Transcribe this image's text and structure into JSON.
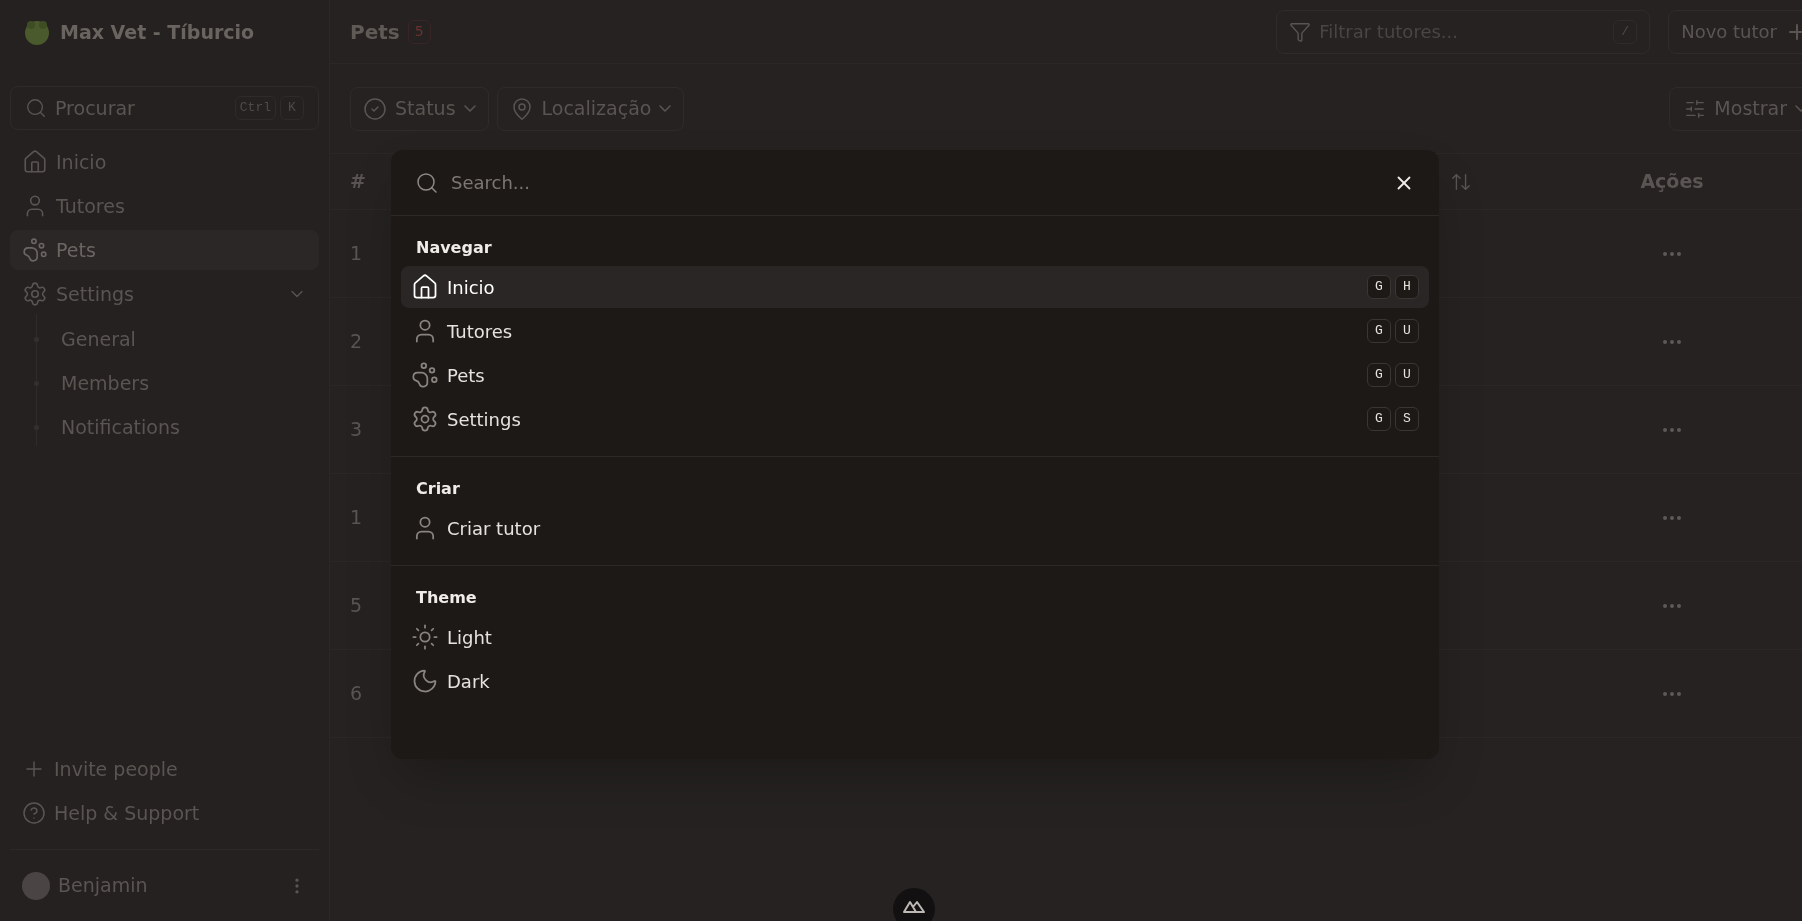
{
  "app": {
    "title": "Max Vet - Tíburcio"
  },
  "sidebar": {
    "search": {
      "placeholder": "Procurar",
      "shortcut": [
        "Ctrl",
        "K"
      ]
    },
    "items": [
      {
        "label": "Inicio",
        "kind": "home",
        "selected": false
      },
      {
        "label": "Tutores",
        "kind": "user",
        "selected": false
      },
      {
        "label": "Pets",
        "kind": "paw",
        "selected": true
      },
      {
        "label": "Settings",
        "kind": "gear",
        "selected": false,
        "expanded": true,
        "children": [
          {
            "label": "General"
          },
          {
            "label": "Members"
          },
          {
            "label": "Notifications"
          }
        ]
      }
    ],
    "footer_items": [
      {
        "label": "Invite people",
        "kind": "plus"
      },
      {
        "label": "Help & Support",
        "kind": "help"
      }
    ],
    "user": {
      "name": "Benjamin"
    }
  },
  "header": {
    "title": "Pets",
    "count": "5",
    "filter": {
      "placeholder": "Filtrar tutores...",
      "shortcut": "/"
    },
    "new_button": "Novo tutor"
  },
  "filters": [
    {
      "label": "Status",
      "kind": "check"
    },
    {
      "label": "Localização",
      "kind": "pin"
    }
  ],
  "display_button": "Mostrar",
  "table": {
    "columns": [
      "#",
      "Ações"
    ],
    "rows": [
      "1",
      "2",
      "3",
      "1",
      "5",
      "6"
    ]
  },
  "command_palette": {
    "search": {
      "placeholder": "Search..."
    },
    "groups": [
      {
        "title": "Navegar",
        "items": [
          {
            "label": "Inicio",
            "kind": "home",
            "selected": true,
            "shortcut": [
              "G",
              "H"
            ]
          },
          {
            "label": "Tutores",
            "kind": "user",
            "selected": false,
            "shortcut": [
              "G",
              "U"
            ]
          },
          {
            "label": "Pets",
            "kind": "paw",
            "selected": false,
            "shortcut": [
              "G",
              "U"
            ]
          },
          {
            "label": "Settings",
            "kind": "gear",
            "selected": false,
            "shortcut": [
              "G",
              "S"
            ]
          }
        ]
      },
      {
        "title": "Criar",
        "items": [
          {
            "label": "Criar tutor",
            "kind": "user",
            "selected": false
          }
        ]
      },
      {
        "title": "Theme",
        "items": [
          {
            "label": "Light",
            "kind": "sun",
            "selected": false
          },
          {
            "label": "Dark",
            "kind": "moon",
            "selected": false
          }
        ]
      }
    ]
  }
}
